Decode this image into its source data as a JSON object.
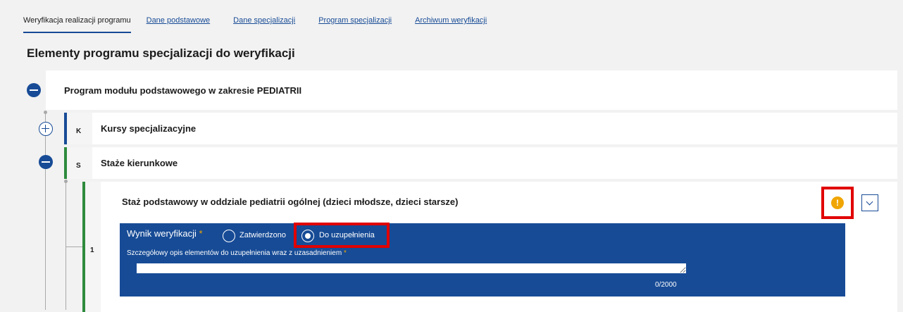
{
  "tabs": [
    {
      "label": "Weryfikacja realizacji programu"
    },
    {
      "label": "Dane podstawowe"
    },
    {
      "label": "Dane specjalizacji"
    },
    {
      "label": "Program specjalizacji"
    },
    {
      "label": "Archiwum weryfikacji"
    }
  ],
  "heading": "Elementy programu specjalizacji do weryfikacji",
  "tree": {
    "module": {
      "title": "Program modułu podstawowego w zakresie PEDIATRII"
    },
    "courses": {
      "tag": "K",
      "title": "Kursy specjalizacyjne",
      "tag_color": "#174b96"
    },
    "internships": {
      "tag": "S",
      "title": "Staże kierunkowe",
      "tag_color": "#2e8b3e"
    },
    "item": {
      "number": "1",
      "title": "Staż podstawowy w oddziale pediatrii ogólnej (dzieci młodsze, dzieci starsze)",
      "warning_icon": "!",
      "tag_color": "#2e8b3e"
    }
  },
  "form": {
    "result_label": "Wynik weryfikacji",
    "required_mark": "*",
    "options": [
      {
        "label": "Zatwierdzono",
        "selected": false
      },
      {
        "label": "Do uzupełnienia",
        "selected": true
      }
    ],
    "description_label": "Szczegółowy opis elementów do uzupełnienia wraz z uzasadnieniem",
    "description_value": "",
    "counter": "0/2000"
  },
  "colors": {
    "primary": "#174b96",
    "warning": "#f0a500",
    "highlight": "#e10000",
    "success": "#2e8b3e"
  }
}
